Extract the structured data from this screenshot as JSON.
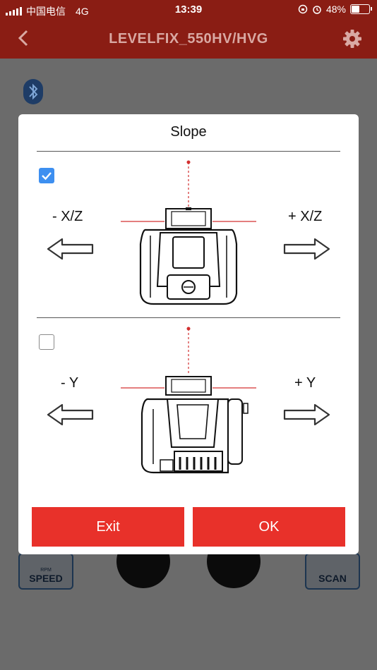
{
  "status_bar": {
    "carrier": "中国电信",
    "network": "4G",
    "time": "13:39",
    "battery": "48%",
    "battery_level": 0.48
  },
  "header": {
    "title": "LEVELFIX_550HV/HVG"
  },
  "background_controls": {
    "speed_label": "SPEED",
    "speed_sub": "RPM",
    "scan_label": "SCAN"
  },
  "dialog": {
    "title": "Slope",
    "sections": [
      {
        "checked": true,
        "minus_label": "- X/Z",
        "plus_label": "+ X/Z"
      },
      {
        "checked": false,
        "minus_label": "- Y",
        "plus_label": "+ Y"
      }
    ],
    "exit_label": "Exit",
    "ok_label": "OK"
  },
  "colors": {
    "header_bg": "#8a1d14",
    "button_red": "#e8312a",
    "checkbox_blue": "#3d8ff0",
    "laser_red": "#d33030"
  }
}
